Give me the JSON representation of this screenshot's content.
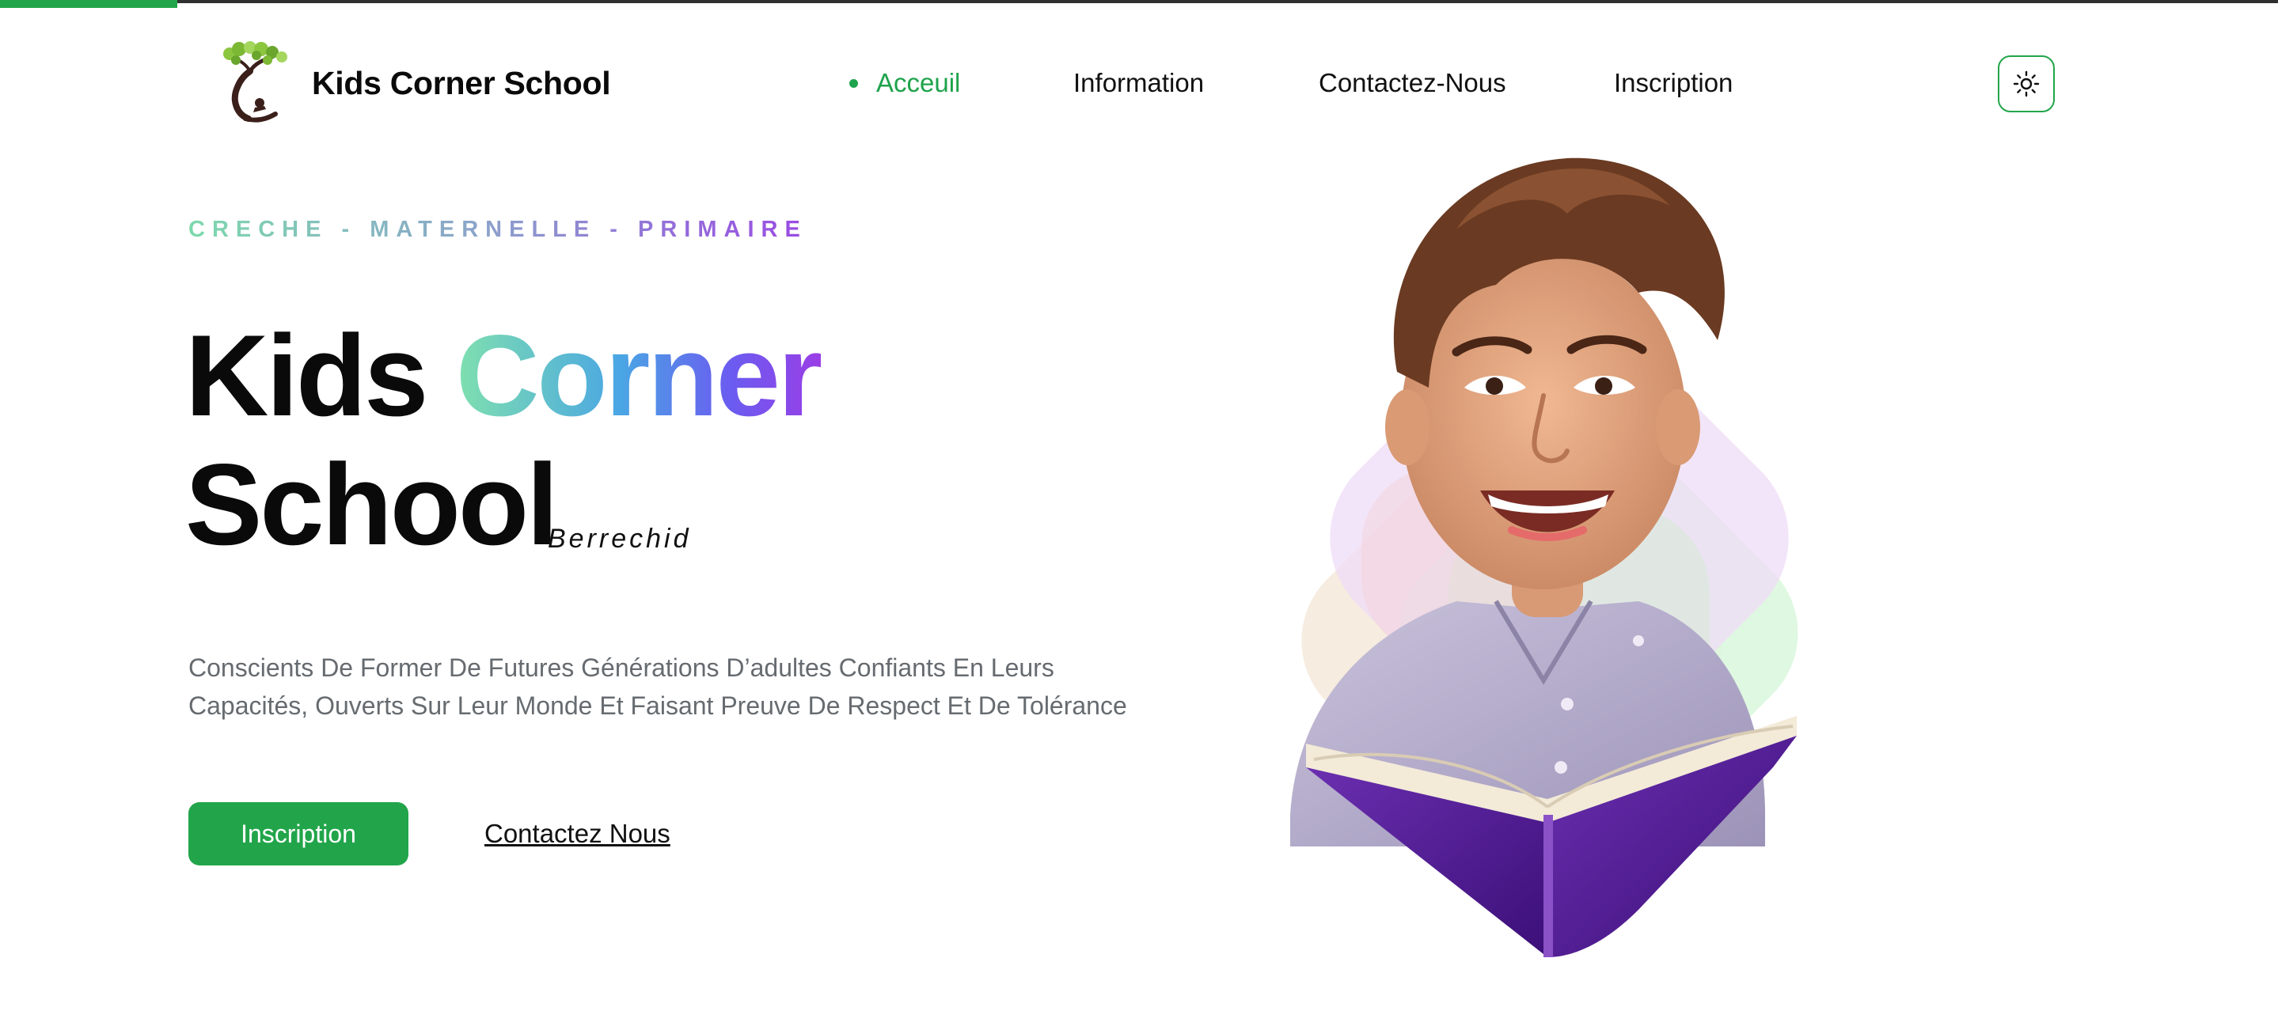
{
  "page": {
    "scroll_progress": 0.078
  },
  "header": {
    "brand": "Kids Corner School",
    "logo_icon": "tree-reading-child-logo",
    "theme_toggle_icon": "sun-icon",
    "nav": [
      {
        "label": "Acceuil",
        "active": true
      },
      {
        "label": "Information",
        "active": false
      },
      {
        "label": "Contactez-Nous",
        "active": false
      },
      {
        "label": "Inscription",
        "active": false
      }
    ]
  },
  "hero": {
    "eyebrow": "CRECHE - MATERNELLE - PRIMAIRE",
    "title_word1": "Kids",
    "title_word2": "Corner",
    "title_word3": "School",
    "city": "Berrechid",
    "description": "Conscients De Former De Futures Générations D’adultes Confiants En Leurs Capacités, Ouverts Sur Leur Monde Et Faisant Preuve De Respect Et De Tolérance",
    "primary_button": "Inscription",
    "secondary_link": "Contactez Nous",
    "image": "smiling-boy-reading-purple-book"
  },
  "colors": {
    "accent": "#22a54a",
    "gradient_start": "#7fe0ae",
    "gradient_mid": "#4aa6e4",
    "gradient_end": "#9a3ee6",
    "body_text": "#666b70"
  }
}
